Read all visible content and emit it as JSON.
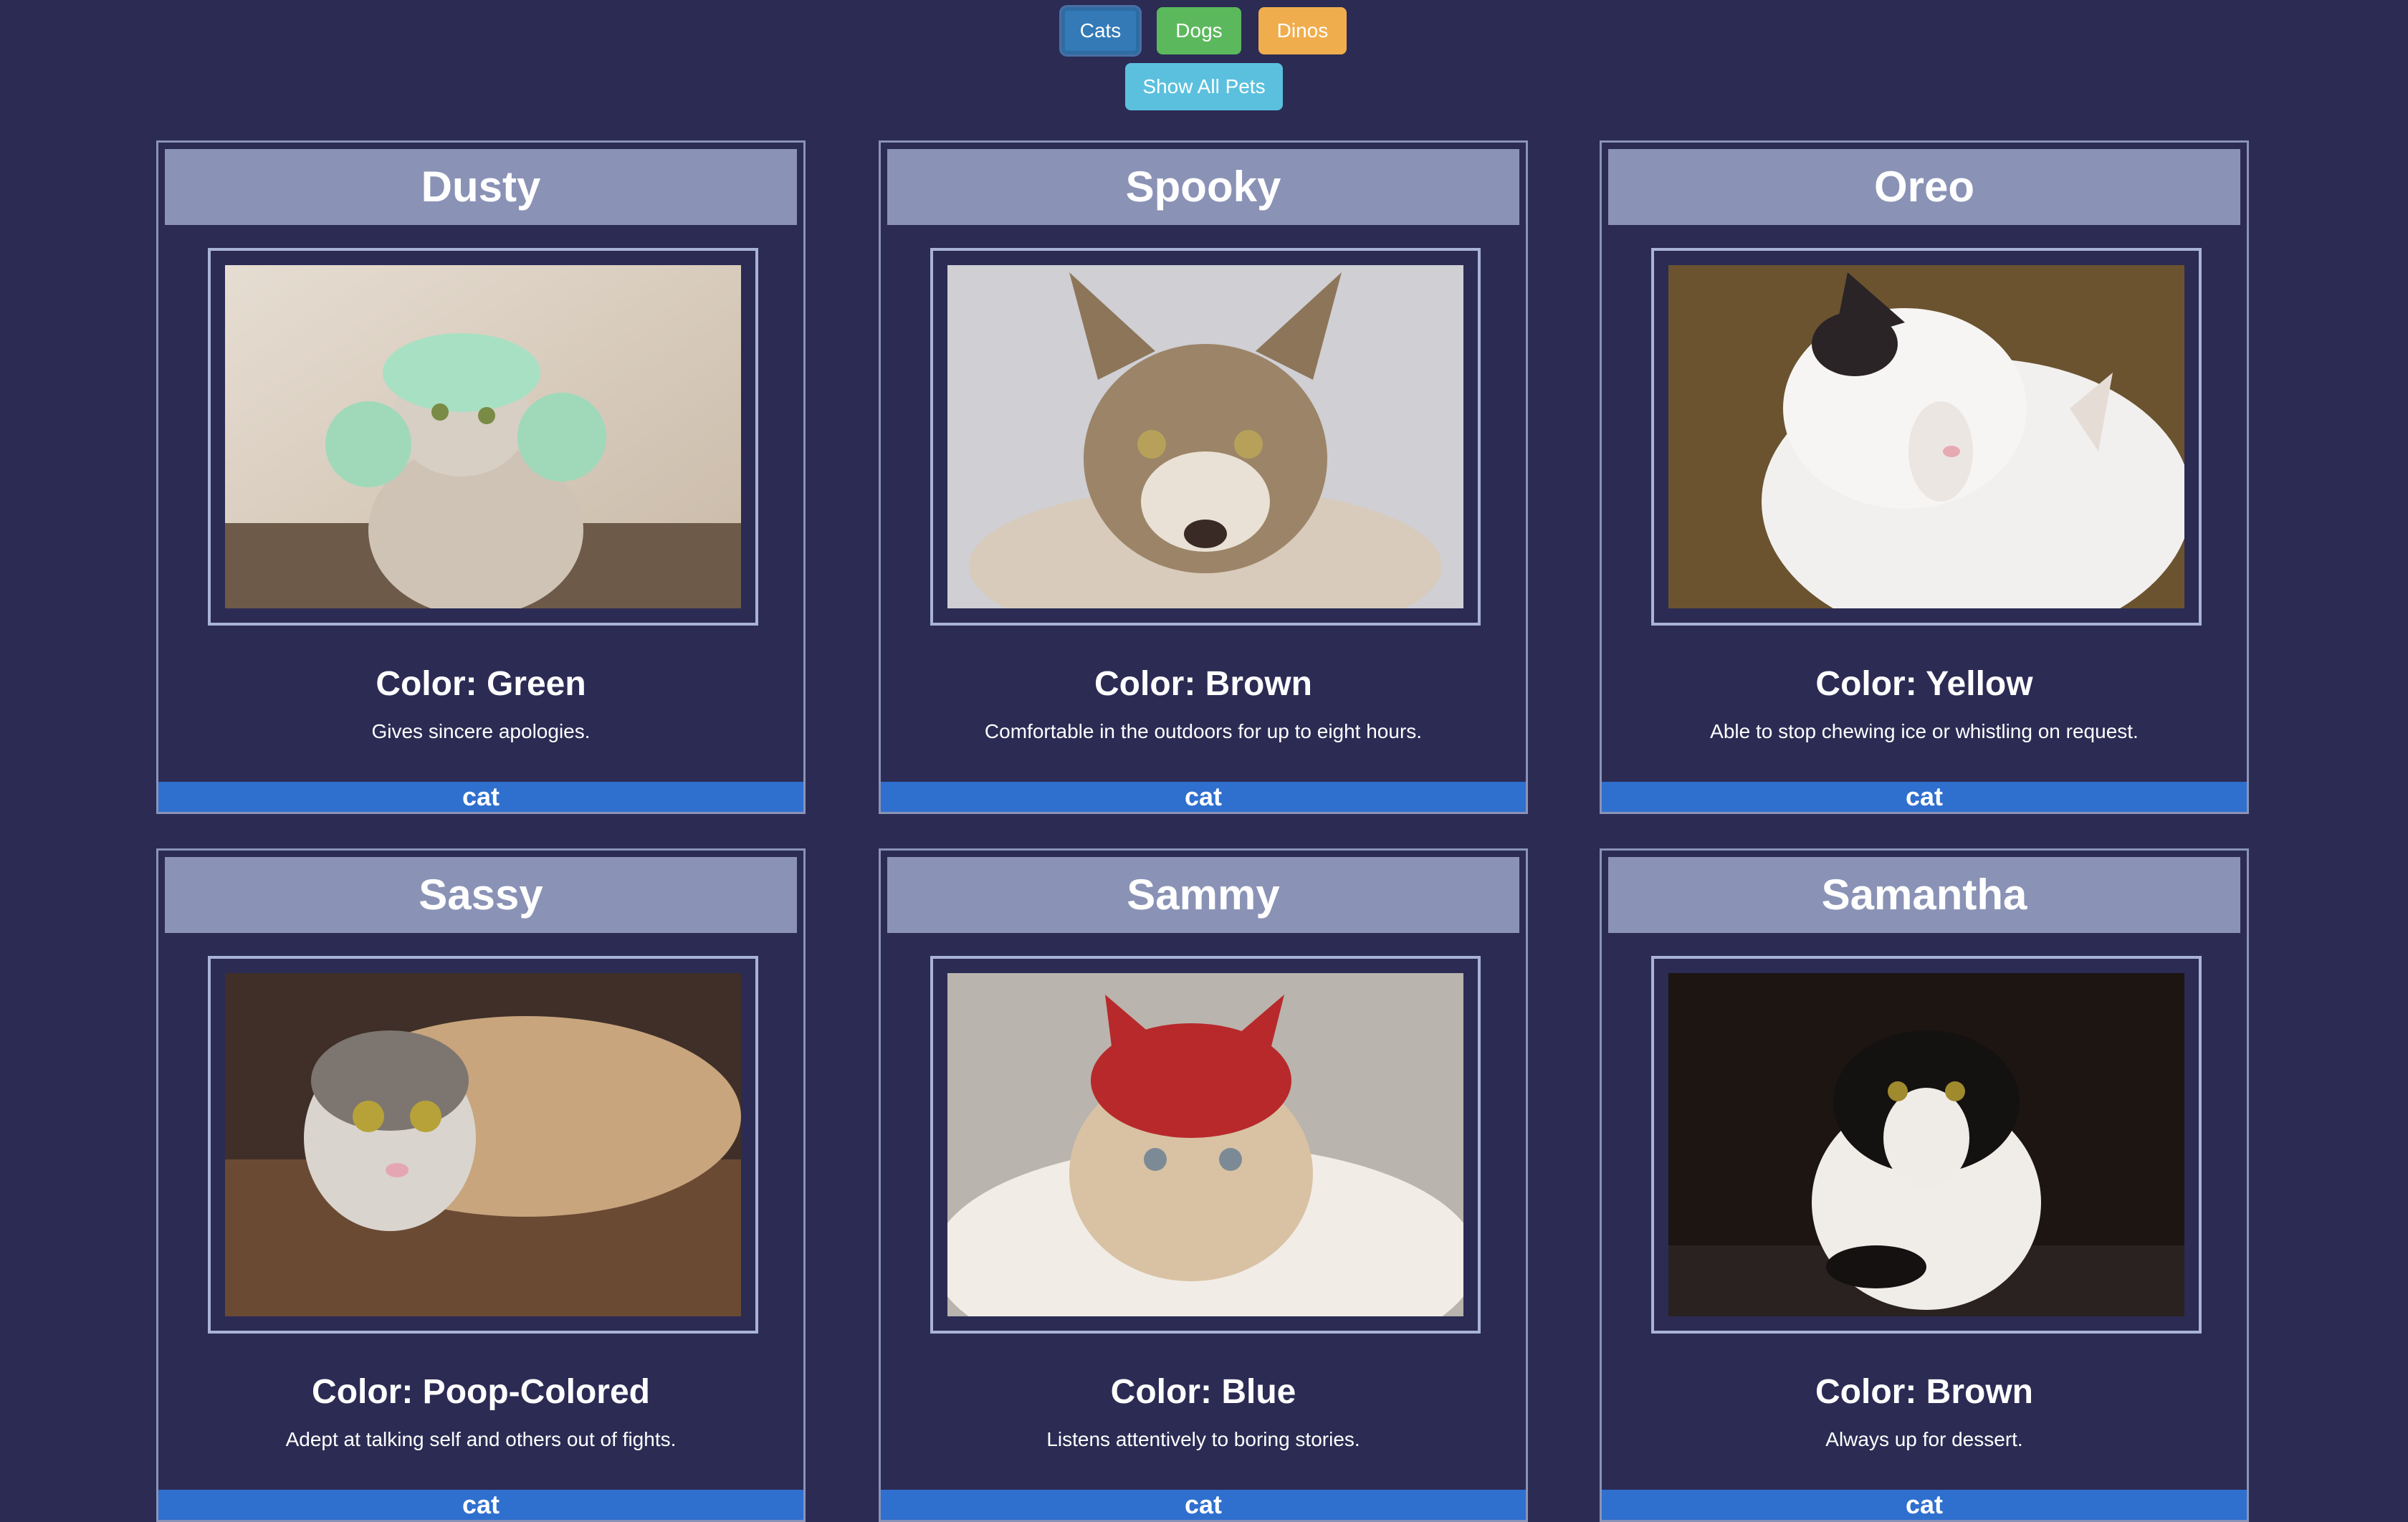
{
  "filters": {
    "cats_label": "Cats",
    "dogs_label": "Dogs",
    "dinos_label": "Dinos",
    "show_all_label": "Show All Pets"
  },
  "pets": [
    {
      "name": "Dusty",
      "color": "Color: Green",
      "description": "Gives sincere apologies.",
      "type": "cat"
    },
    {
      "name": "Spooky",
      "color": "Color: Brown",
      "description": "Comfortable in the outdoors for up to eight hours.",
      "type": "cat"
    },
    {
      "name": "Oreo",
      "color": "Color: Yellow",
      "description": "Able to stop chewing ice or whistling on request.",
      "type": "cat"
    },
    {
      "name": "Sassy",
      "color": "Color: Poop-Colored",
      "description": "Adept at talking self and others out of fights.",
      "type": "cat"
    },
    {
      "name": "Sammy",
      "color": "Color: Blue",
      "description": "Listens attentively to boring stories.",
      "type": "cat"
    },
    {
      "name": "Samantha",
      "color": "Color: Brown",
      "description": "Always up for dessert.",
      "type": "cat"
    }
  ],
  "theme": {
    "background": "#2b2b54",
    "card_header": "#8a93b6",
    "type_bar": "#2f6fce"
  }
}
